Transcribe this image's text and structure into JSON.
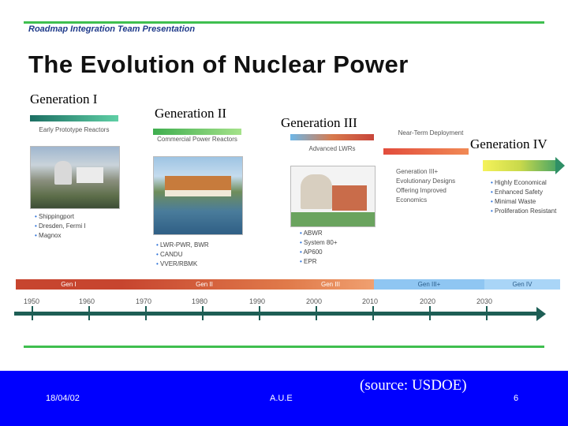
{
  "header": {
    "title": "Roadmap Integration Team Presentation"
  },
  "slide": {
    "title": "The Evolution of Nuclear Power"
  },
  "generations": [
    {
      "label": "Generation I",
      "caption": "Early Prototype Reactors",
      "items": [
        "Shippingport",
        "Dresden, Fermi I",
        "Magnox"
      ]
    },
    {
      "label": "Generation II",
      "caption": "Commercial Power Reactors",
      "items": [
        "LWR-PWR, BWR",
        "CANDU",
        "VVER/RBMK"
      ]
    },
    {
      "label": "Generation III",
      "caption": "Advanced LWRs",
      "items": [
        "ABWR",
        "System 80+",
        "AP600",
        "EPR"
      ]
    },
    {
      "label": "Generation IV",
      "items": [
        "Highly Economical",
        "Enhanced Safety",
        "Minimal Waste",
        "Proliferation Resistant"
      ]
    }
  ],
  "near_term": {
    "caption": "Near-Term Deployment",
    "description": "Generation III+ Evolutionary Designs Offering Improved Economics"
  },
  "timeline": {
    "segments": [
      "Gen I",
      "Gen II",
      "Gen III",
      "Gen III+",
      "Gen IV"
    ],
    "years": [
      "1950",
      "1960",
      "1970",
      "1980",
      "1990",
      "2000",
      "2010",
      "2020",
      "2030"
    ]
  },
  "footer": {
    "date": "18/04/02",
    "org": "A.U.E",
    "source": "(source: USDOE)",
    "page": "6"
  },
  "colors": {
    "footer_bg": "#0000ff",
    "rule": "#3fbf4f",
    "timeline": "#1d5e55"
  }
}
